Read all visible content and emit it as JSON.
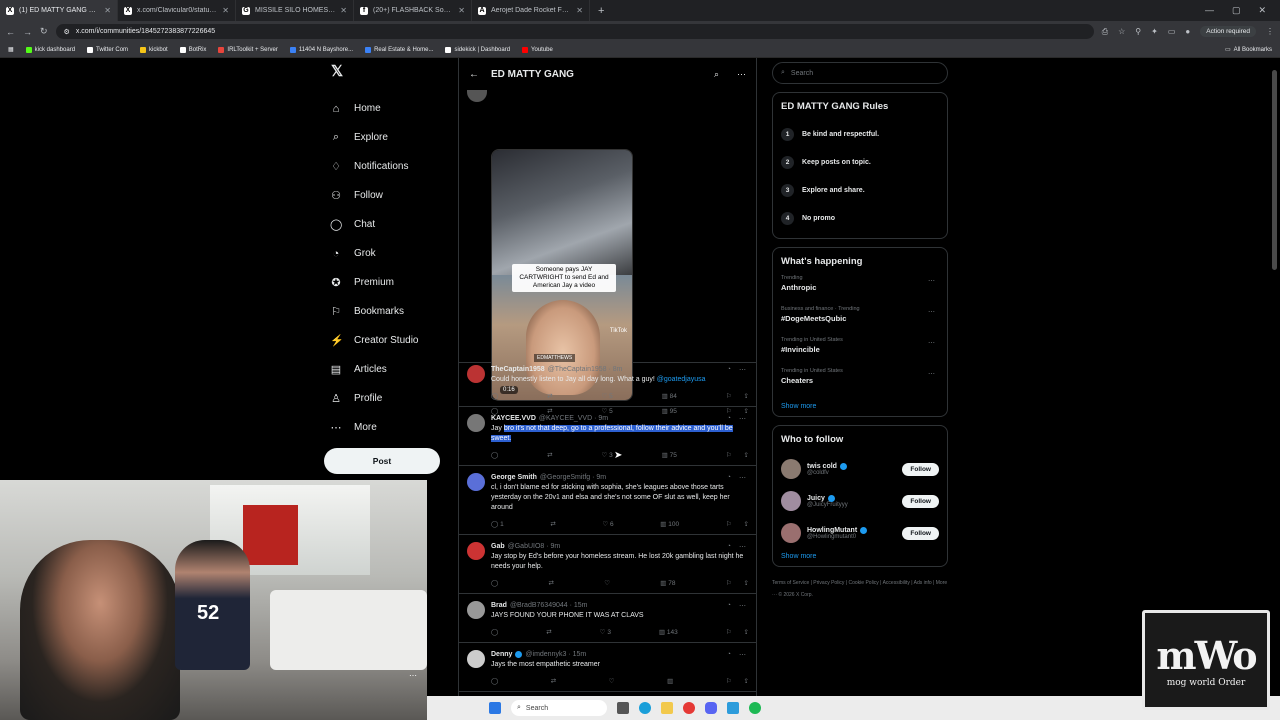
{
  "browser": {
    "tabs": [
      {
        "label": "(1) ED MATTY GANG Communi",
        "icon": "X",
        "active": true
      },
      {
        "label": "x.com/Clavicular0/status/2039",
        "icon": "X",
        "active": false
      },
      {
        "label": "MISSILE SILO HOMESTEAD - G",
        "icon": "G",
        "active": false
      },
      {
        "label": "(20+) FLASHBACK South Floridi",
        "icon": "f",
        "active": false
      },
      {
        "label": "Aerojet Dade Rocket Facility |",
        "icon": "A",
        "active": false
      }
    ],
    "new_tab": "+",
    "url": "x.com/i/communities/1845272383877226645",
    "action_required": "Action required",
    "bookmarks": [
      {
        "label": "kick dashboard",
        "color": "#53fc18"
      },
      {
        "label": "Twitter Com",
        "color": "#ffffff"
      },
      {
        "label": "kickbot",
        "color": "#f5c518"
      },
      {
        "label": "BotRix",
        "color": "#ffffff"
      },
      {
        "label": "IRLToolkit + Server",
        "color": "#e8453c"
      },
      {
        "label": "11404 N Bayshore...",
        "color": "#3b82f6"
      },
      {
        "label": "Real Estate & Home...",
        "color": "#3b82f6"
      },
      {
        "label": "sidekick | Dashboard",
        "color": "#ffffff"
      },
      {
        "label": "Youtube",
        "color": "#ff0000"
      }
    ],
    "all_bookmarks": "All Bookmarks"
  },
  "nav": {
    "logo": "𝕏",
    "items": [
      {
        "label": "Home",
        "icon": "⌂"
      },
      {
        "label": "Explore",
        "icon": "⌕"
      },
      {
        "label": "Notifications",
        "icon": "♢"
      },
      {
        "label": "Follow",
        "icon": "⚇"
      },
      {
        "label": "Chat",
        "icon": "◯"
      },
      {
        "label": "Grok",
        "icon": "◔"
      },
      {
        "label": "Premium",
        "icon": "✪"
      },
      {
        "label": "Bookmarks",
        "icon": "⚐"
      },
      {
        "label": "Creator Studio",
        "icon": "⚡"
      },
      {
        "label": "Articles",
        "icon": "▤"
      },
      {
        "label": "Profile",
        "icon": "♙"
      },
      {
        "label": "More",
        "icon": "⋯"
      }
    ],
    "post_button": "Post"
  },
  "main": {
    "title": "ED MATTY GANG",
    "video_post": {
      "caption": "Someone pays JAY CARTWRIGHT to send Ed and American Jay a video",
      "tag": "EDMATTHEWS",
      "watermark": "TikTok",
      "duration": "0:16",
      "likes": "5",
      "views": "95"
    },
    "tweets": [
      {
        "name": "TheCaptain1958",
        "handle": "@TheCaptain1958 · 8m",
        "text": "Could honestly listen to Jay all day long. What a guy! ",
        "mention": "@goatedjayusa",
        "replies": "",
        "reposts": "",
        "likes": "5",
        "views": "84",
        "avatar": "#b33"
      },
      {
        "name": "KAYCEE.VVD",
        "handle": "@KAYCEE_VVD · 9m",
        "text_plain": "Jay ",
        "text_sel": "bro it's not that deep, go to a professional, follow their advice and you'll be sweet.",
        "replies": "",
        "reposts": "",
        "likes": "3",
        "views": "75",
        "avatar": "#777"
      },
      {
        "name": "George Smith",
        "handle": "@GeorgeSmitfg · 9m",
        "text": "cl, i don't blame ed for sticking with sophia, she's leagues above those tarts yesterday on the 20v1 and elsa and she's not some OF slut as well, keep her around",
        "replies": "1",
        "reposts": "",
        "likes": "6",
        "views": "100",
        "avatar": "#5a6fd8"
      },
      {
        "name": "Gab",
        "handle": "@GabUIO8 · 9m",
        "text": "Jay stop by Ed's before your homeless stream. He lost 20k gambling last night he needs your help.",
        "replies": "",
        "reposts": "",
        "likes": "",
        "views": "78",
        "avatar": "#c33"
      },
      {
        "name": "Brad",
        "handle": "@BradB76349044 · 15m",
        "text": "JAYS FOUND YOUR PHONE IT WAS AT CLAVS",
        "replies": "",
        "reposts": "",
        "likes": "3",
        "views": "143",
        "avatar": "#999"
      },
      {
        "name": "Denny",
        "handle": "@imdennyk3 · 15m",
        "text": "Jays the most empathetic streamer ",
        "replies": "",
        "reposts": "",
        "likes": "",
        "views": "",
        "avatar": "#ccc"
      }
    ]
  },
  "right": {
    "search_placeholder": "Search",
    "rules_title": "ED MATTY GANG Rules",
    "rules": [
      {
        "num": "1",
        "label": "Be kind and respectful."
      },
      {
        "num": "2",
        "label": "Keep posts on topic."
      },
      {
        "num": "3",
        "label": "Explore and share."
      },
      {
        "num": "4",
        "label": "No promo"
      }
    ],
    "happening_title": "What's happening",
    "trends": [
      {
        "meta": "Trending",
        "topic": "Anthropic"
      },
      {
        "meta": "Business and finance · Trending",
        "topic": "#DogeMeetsQubic"
      },
      {
        "meta": "Trending in United States",
        "topic": "#Invincible"
      },
      {
        "meta": "Trending in United States",
        "topic": "Cheaters"
      }
    ],
    "show_more": "Show more",
    "who_title": "Who to follow",
    "who": [
      {
        "name": "twis cold",
        "handle": "@coldfv",
        "avatar": "#8a7a70"
      },
      {
        "name": "Juicy",
        "handle": "@JuicyFruityyy",
        "avatar": "#a08da0"
      },
      {
        "name": "HowlingMutant",
        "handle": "@Howlingmutant0",
        "avatar": "#9a6f6f"
      }
    ],
    "follow_label": "Follow",
    "footer": "Terms of Service  |  Privacy Policy  |  Cookie Policy  |  Accessibility  |  Ads info  |  More ···  © 2026 X Corp."
  },
  "overlay": {
    "jersey": "52",
    "mwo_big": "mWo",
    "mwo_small": "mog world Order"
  },
  "taskbar": {
    "search_placeholder": "Search"
  }
}
